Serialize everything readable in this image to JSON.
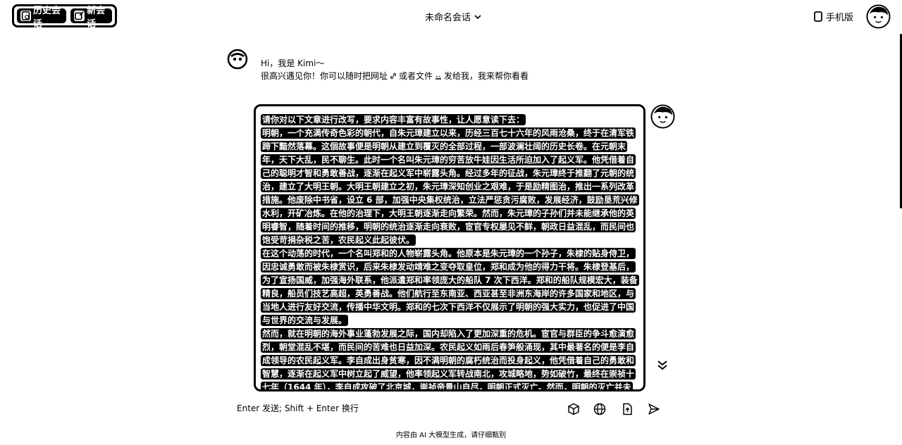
{
  "header": {
    "history_label": "历史会话",
    "new_chat_label": "新会话",
    "title": "未命名会话",
    "mobile_label": "手机版"
  },
  "greeting": {
    "line1": "Hi，我是 Kimi～",
    "line2_a": "很高兴遇见你！你可以随时把网址",
    "line2_b": "或者文件",
    "line2_c": "发给我，我来帮你看看"
  },
  "user_message": {
    "paragraphs": [
      "请你对以下文章进行改写，要求内容丰富有故事性，让人愿意读下去：",
      "明朝，一个充满传奇色彩的朝代，自朱元璋建立以来，历经三百七十六年的风雨沧桑，终于在清军铁蹄下黯然落幕。这個故事便是明朝从建立到覆灭的全部过程，一部波澜壮阔的历史长卷。在元朝末年，天下大乱，民不聊生。此时一个名叫朱元璋的穷苦放牛娃因生活所迫加入了起义军。他凭借着自己的聪明才智和勇敢善战，逐渐在起义军中崭露头角。经过多年的征战，朱元璋终于推翻了元朝的统治，建立了大明王朝。大明王朝建立之初，朱元璋深知创业之艰难，于是励精图治，推出一系列改革措施。他废除中书省，设立 6 部，加强中央集权统治，立法严惩贪污腐败，发展经济，鼓励垦荒兴修水利，开矿冶炼。在他的治理下，大明王朝逐渐走向繁荣。然而，朱元璋的子孙们并未能继承他的英明睿智，随着时间的推移，明朝的统治逐渐走向衰败，宦官专权屡见不鲜，朝政日益混乱，而民间也饱受苛捐杂税之苦，农民起义此起彼伏。",
      "在这个动荡的时代，一个名叫郑和的人物崭露头角。他原本是朱元璋的一个孙子，朱棣的贴身侍卫，因忠诚勇敢而被朱棣赏识，后来朱棣发动靖难之变夺取皇位，郑和成为他的得力干将。朱棣登基后，为了宣扬国威，加强海外联系，他派遣郑和率领庞大的船队 7 次下西洋。郑和的船队规模宏大，装备精良，船员们技艺高超，英勇善战。他们航行至东南亚、西亚甚至非洲东海岸的许多国家和地区，与当地人进行友好交流，传播中华文明。郑和的七次下西洋不仅展示了明朝的强大实力，也促进了中国与世界的交流与发展。",
      "然而，就在明朝的海外事业蓬勃发展之际，国内却陷入了更加深重的危机。宦官与群臣的争斗愈演愈烈，朝堂混乱不堪，而民间的苦难也日益加深。农民起义如雨后春笋般涌现，其中最著名的便是李自成领导的农民起义军。李自成出身贫寒，因不满明朝的腐朽统治而投身起义，他凭借着自己的勇敢和智慧，逐渐在起义军中树立起了威望，他率领起义军转战南北，攻城略地，势如破竹，最终在崇祯十七年（1644 年），李自成攻破了北京城，崇祯帝景山自尽，明朝正式灭亡。然而，明朝的灭亡并未给百姓带来太平安宁，李自成入主北京后，由于缺乏治国经验和远见卓识，很快便失去了民心。"
    ]
  },
  "input": {
    "placeholder": "Enter 发送; Shift + Enter 换行"
  },
  "tools": [
    "cube-icon",
    "globe-icon",
    "file-upload-icon",
    "send-icon"
  ],
  "footer": {
    "disclaimer": "内容由 AI 大模型生成，请仔细甄别"
  }
}
